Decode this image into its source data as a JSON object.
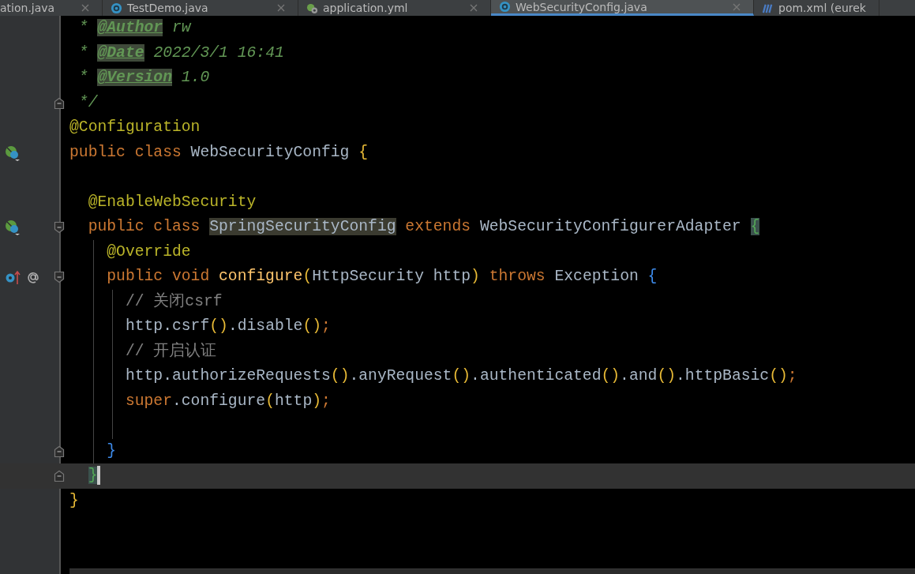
{
  "tabs": [
    {
      "label": "ation.java",
      "selected": false,
      "closable": true
    },
    {
      "label": "TestDemo.java",
      "selected": false,
      "closable": true
    },
    {
      "label": "application.yml",
      "selected": false,
      "closable": true
    },
    {
      "label": "WebSecurityConfig.java",
      "selected": true,
      "closable": true
    },
    {
      "label": "pom.xml (eurek",
      "selected": false,
      "closable": false
    }
  ],
  "lines": [
    {
      "tokens": [
        {
          "t": " * ",
          "kind": "doc"
        },
        {
          "t": "@Author",
          "kind": "doctag"
        },
        {
          "t": " rw",
          "kind": "doc"
        }
      ]
    },
    {
      "tokens": [
        {
          "t": " * ",
          "kind": "doc"
        },
        {
          "t": "@Date",
          "kind": "doctag"
        },
        {
          "t": " 2022/3/1 16:41",
          "kind": "doc"
        }
      ]
    },
    {
      "tokens": [
        {
          "t": " * ",
          "kind": "doc"
        },
        {
          "t": "@Version",
          "kind": "doctag"
        },
        {
          "t": " 1.0",
          "kind": "doc"
        }
      ]
    },
    {
      "tokens": [
        {
          "t": " */",
          "kind": "doc"
        }
      ]
    },
    {
      "tokens": [
        {
          "t": "@Configuration",
          "kind": "annotation"
        }
      ]
    },
    {
      "tokens": [
        {
          "t": "public class ",
          "kind": "keyword"
        },
        {
          "t": "WebSecurityConfig ",
          "kind": "plain"
        },
        {
          "t": "{",
          "kind": "brace1"
        }
      ]
    },
    {
      "kind": "blank"
    },
    {
      "tokens": [
        {
          "t": "  @EnableWebSecurity",
          "kind": "annotation"
        }
      ]
    },
    {
      "tokens": [
        {
          "t": "  public class ",
          "kind": "keyword"
        },
        {
          "t": "SpringSecurityConfig",
          "kind": "usage"
        },
        {
          "t": " extends ",
          "kind": "keyword"
        },
        {
          "t": "WebSecurityConfigurerAdapter ",
          "kind": "plain"
        },
        {
          "t": "{",
          "kind": "bracematch"
        }
      ]
    },
    {
      "tokens": [
        {
          "t": "    @Override",
          "kind": "annotation"
        }
      ]
    },
    {
      "tokens": [
        {
          "t": "    public void ",
          "kind": "keyword"
        },
        {
          "t": "configure",
          "kind": "method"
        },
        {
          "t": "(",
          "kind": "paren"
        },
        {
          "t": "HttpSecurity http",
          "kind": "plain"
        },
        {
          "t": ")",
          "kind": "paren"
        },
        {
          "t": " throws ",
          "kind": "keyword"
        },
        {
          "t": "Exception ",
          "kind": "plain"
        },
        {
          "t": "{",
          "kind": "brace3"
        }
      ]
    },
    {
      "tokens": [
        {
          "t": "      // 关闭csrf",
          "kind": "comment"
        }
      ]
    },
    {
      "tokens": [
        {
          "t": "      http.csrf",
          "kind": "plain"
        },
        {
          "t": "()",
          "kind": "paren"
        },
        {
          "t": ".disable",
          "kind": "plain"
        },
        {
          "t": "()",
          "kind": "paren"
        },
        {
          "t": ";",
          "kind": "keyword"
        }
      ]
    },
    {
      "tokens": [
        {
          "t": "      // 开启认证",
          "kind": "comment"
        }
      ]
    },
    {
      "tokens": [
        {
          "t": "      http.authorizeRequests",
          "kind": "plain"
        },
        {
          "t": "()",
          "kind": "paren"
        },
        {
          "t": ".anyRequest",
          "kind": "plain"
        },
        {
          "t": "()",
          "kind": "paren"
        },
        {
          "t": ".authenticated",
          "kind": "plain"
        },
        {
          "t": "()",
          "kind": "paren"
        },
        {
          "t": ".and",
          "kind": "plain"
        },
        {
          "t": "()",
          "kind": "paren"
        },
        {
          "t": ".httpBasic",
          "kind": "plain"
        },
        {
          "t": "()",
          "kind": "paren"
        },
        {
          "t": ";",
          "kind": "keyword"
        }
      ]
    },
    {
      "tokens": [
        {
          "t": "      super",
          "kind": "keyword"
        },
        {
          "t": ".configure",
          "kind": "plain"
        },
        {
          "t": "(",
          "kind": "paren"
        },
        {
          "t": "http",
          "kind": "plain"
        },
        {
          "t": ")",
          "kind": "paren"
        },
        {
          "t": ";",
          "kind": "keyword"
        }
      ]
    },
    {
      "kind": "blank"
    },
    {
      "tokens": [
        {
          "t": "    }",
          "kind": "brace3"
        }
      ]
    },
    {
      "current": true,
      "tokens": [
        {
          "t": "  }",
          "kind": "bracematch"
        }
      ]
    },
    {
      "tokens": [
        {
          "t": "}",
          "kind": "brace1"
        }
      ]
    }
  ]
}
